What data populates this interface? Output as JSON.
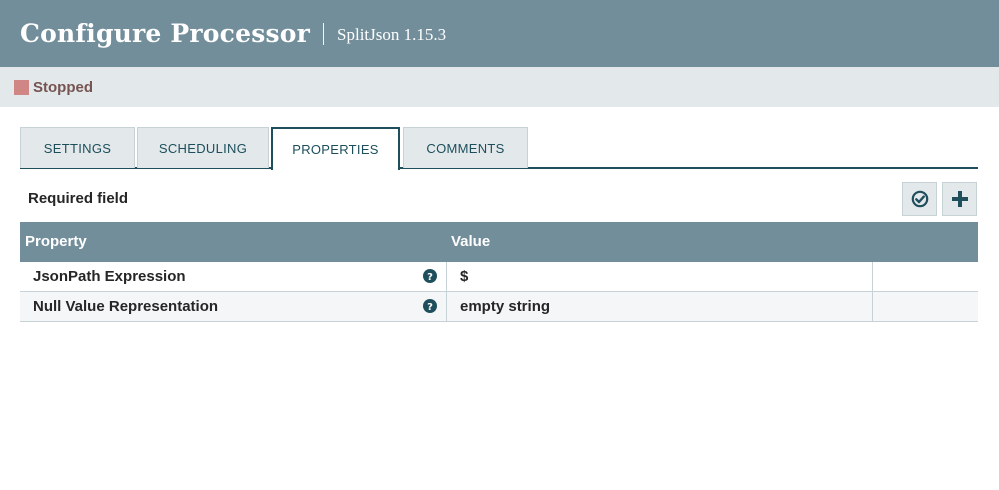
{
  "header": {
    "title": "Configure Processor",
    "subtitle": "SplitJson 1.15.3"
  },
  "status": {
    "label": "Stopped",
    "color": "#d18686"
  },
  "tabs": [
    {
      "label": "SETTINGS",
      "active": false
    },
    {
      "label": "SCHEDULING",
      "active": false
    },
    {
      "label": "PROPERTIES",
      "active": true
    },
    {
      "label": "COMMENTS",
      "active": false
    }
  ],
  "properties": {
    "required_label": "Required field",
    "toolbar_icons": [
      "verify-icon",
      "add-icon"
    ],
    "columns": {
      "property": "Property",
      "value": "Value"
    },
    "rows": [
      {
        "name": "JsonPath Expression",
        "value": "$",
        "help_icon": "question-circle-icon"
      },
      {
        "name": "Null Value Representation",
        "value": "empty string",
        "help_icon": "question-circle-icon"
      }
    ]
  },
  "colors": {
    "header_bg": "#728e9b",
    "accent": "#1f4f5c",
    "status_bar_bg": "#e3e8eb"
  }
}
